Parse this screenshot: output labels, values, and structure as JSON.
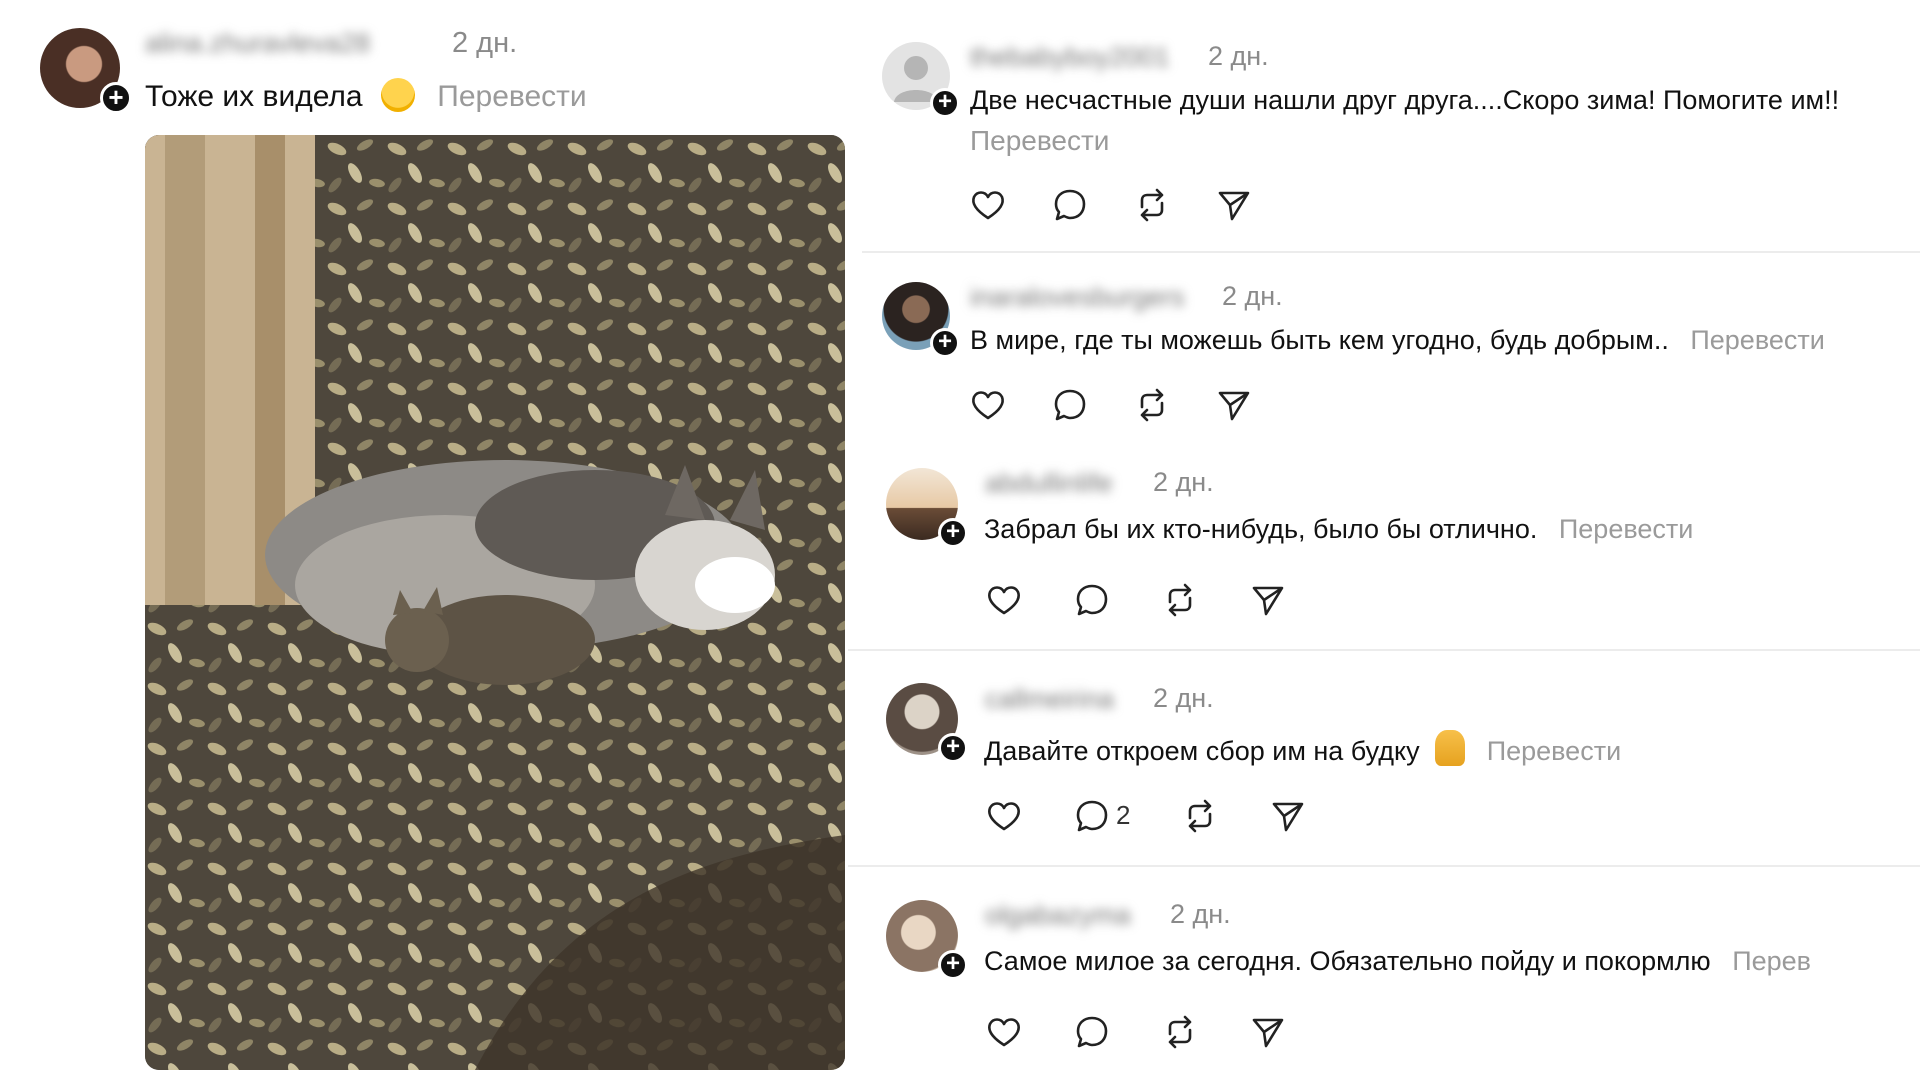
{
  "post": {
    "username": "alina.zhuravleva28",
    "time": "2 дн.",
    "text": "Тоже их видела",
    "translate": "Перевести"
  },
  "comments": [
    {
      "username": "thebabyboy2001",
      "time": "2 дн.",
      "text": "Две несчастные души нашли друг друга....Скоро зима! Помогите им!!",
      "translate": "Перевести",
      "reply_count": ""
    },
    {
      "username": "inaralovesburgers",
      "time": "2 дн.",
      "text": "В мире, где ты можешь быть кем угодно, будь добрым..",
      "translate": "Перевести",
      "reply_count": ""
    },
    {
      "username": "abdullinlife",
      "time": "2 дн.",
      "text": "Забрал бы их кто-нибудь, было бы отлично.",
      "translate": "Перевести",
      "reply_count": ""
    },
    {
      "username": "callmeirina",
      "time": "2 дн.",
      "text": "Давайте откроем сбор им на будку",
      "translate": "Перевести",
      "reply_count": "2"
    },
    {
      "username": "olgabazyma",
      "time": "2 дн.",
      "text": "Самое милое за сегодня. Обязательно пойду и покормлю",
      "translate": "Перев",
      "reply_count": ""
    }
  ],
  "icons": {
    "like": "heart-icon",
    "reply": "comment-icon",
    "repost": "repost-icon",
    "share": "send-icon",
    "follow": "plus-icon"
  }
}
